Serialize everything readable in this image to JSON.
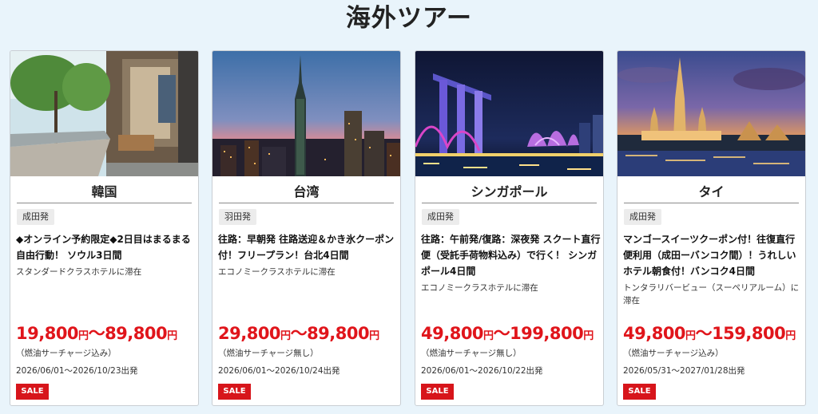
{
  "page_title": "海外ツアー",
  "cards": [
    {
      "image": "seoul-street-photo",
      "destination": "韓国",
      "origin": "成田発",
      "description": "◆オンライン予約限定◆2日目はまるまる自由行動！ ソウル3日間",
      "hotel": "スタンダードクラスホテルに滞在",
      "price_min": "19,800",
      "price_sep": "～",
      "price_max": "89,800",
      "currency": "円",
      "surcharge": "（燃油サーチャージ込み）",
      "period": "2026/06/01～2026/10/23出発",
      "badge": "SALE"
    },
    {
      "image": "taipei-101-skyline-photo",
      "destination": "台湾",
      "origin": "羽田発",
      "description": "往路：早朝発 往路送迎＆かき氷クーポン付！フリープラン！台北4日間",
      "hotel": "エコノミークラスホテルに滞在",
      "price_min": "29,800",
      "price_sep": "～",
      "price_max": "89,800",
      "currency": "円",
      "surcharge": "（燃油サーチャージ無し）",
      "period": "2026/06/01～2026/10/24出発",
      "badge": "SALE"
    },
    {
      "image": "singapore-marina-bay-night-photo",
      "destination": "シンガポール",
      "origin": "成田発",
      "description": "往路：午前発/復路：深夜発 スクート直行便（受託手荷物料込み）で行く！ シンガポール4日間",
      "hotel": "エコノミークラスホテルに滞在",
      "price_min": "49,800",
      "price_sep": "～",
      "price_max": "199,800",
      "currency": "円",
      "surcharge": "（燃油サーチャージ無し）",
      "period": "2026/06/01～2026/10/22出発",
      "badge": "SALE"
    },
    {
      "image": "bangkok-wat-arun-dusk-photo",
      "destination": "タイ",
      "origin": "成田発",
      "description": "マンゴースイーツクーポン付！往復直行便利用（成田ーバンコク間）！うれしいホテル朝食付！バンコク4日間",
      "hotel": "トンタラリバービュー（スーペリアルーム）に滞在",
      "price_min": "49,800",
      "price_sep": "～",
      "price_max": "159,800",
      "currency": "円",
      "surcharge": "（燃油サーチャージ込み）",
      "period": "2026/05/31～2027/01/28出発",
      "badge": "SALE"
    }
  ]
}
